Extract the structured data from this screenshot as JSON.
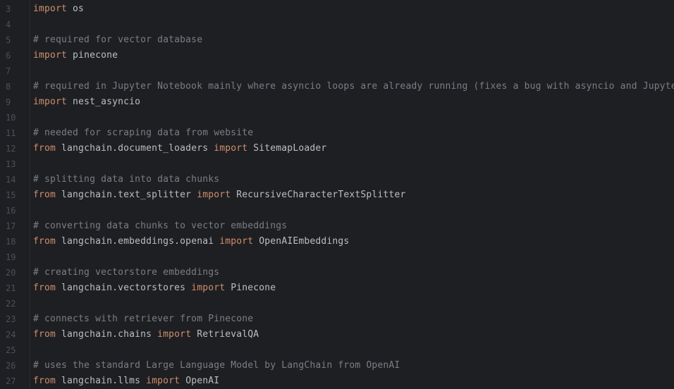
{
  "colors": {
    "background": "#1e1f22",
    "line_number": "#4b5059",
    "keyword": "#cf8e6d",
    "comment": "#7a7e85",
    "identifier": "#bcbec4"
  },
  "lines": [
    {
      "num": "3",
      "tokens": [
        {
          "t": "kw",
          "v": "import"
        },
        {
          "t": "ident",
          "v": " os"
        }
      ]
    },
    {
      "num": "4",
      "tokens": []
    },
    {
      "num": "5",
      "tokens": [
        {
          "t": "cmt",
          "v": "# required for vector database"
        }
      ]
    },
    {
      "num": "6",
      "tokens": [
        {
          "t": "kw",
          "v": "import"
        },
        {
          "t": "ident",
          "v": " pinecone"
        }
      ]
    },
    {
      "num": "7",
      "tokens": []
    },
    {
      "num": "8",
      "tokens": [
        {
          "t": "cmt",
          "v": "# required in Jupyter Notebook mainly where asyncio loops are already running (fixes a bug with asyncio and Jupyter)"
        }
      ]
    },
    {
      "num": "9",
      "tokens": [
        {
          "t": "kw",
          "v": "import"
        },
        {
          "t": "ident",
          "v": " nest_asyncio"
        }
      ]
    },
    {
      "num": "10",
      "tokens": []
    },
    {
      "num": "11",
      "tokens": [
        {
          "t": "cmt",
          "v": "# needed for scraping data from website"
        }
      ]
    },
    {
      "num": "12",
      "tokens": [
        {
          "t": "kw",
          "v": "from"
        },
        {
          "t": "ident",
          "v": " langchain.document_loaders "
        },
        {
          "t": "kw",
          "v": "import"
        },
        {
          "t": "ident",
          "v": " SitemapLoader"
        }
      ]
    },
    {
      "num": "13",
      "tokens": []
    },
    {
      "num": "14",
      "tokens": [
        {
          "t": "cmt",
          "v": "# splitting data into data chunks"
        }
      ]
    },
    {
      "num": "15",
      "tokens": [
        {
          "t": "kw",
          "v": "from"
        },
        {
          "t": "ident",
          "v": " langchain.text_splitter "
        },
        {
          "t": "kw",
          "v": "import"
        },
        {
          "t": "ident",
          "v": " RecursiveCharacterTextSplitter"
        }
      ]
    },
    {
      "num": "16",
      "tokens": []
    },
    {
      "num": "17",
      "tokens": [
        {
          "t": "cmt",
          "v": "# converting data chunks to vector embeddings"
        }
      ]
    },
    {
      "num": "18",
      "tokens": [
        {
          "t": "kw",
          "v": "from"
        },
        {
          "t": "ident",
          "v": " langchain.embeddings.openai "
        },
        {
          "t": "kw",
          "v": "import"
        },
        {
          "t": "ident",
          "v": " OpenAIEmbeddings"
        }
      ]
    },
    {
      "num": "19",
      "tokens": []
    },
    {
      "num": "20",
      "tokens": [
        {
          "t": "cmt",
          "v": "# creating vectorstore embeddings"
        }
      ]
    },
    {
      "num": "21",
      "tokens": [
        {
          "t": "kw",
          "v": "from"
        },
        {
          "t": "ident",
          "v": " langchain.vectorstores "
        },
        {
          "t": "kw",
          "v": "import"
        },
        {
          "t": "ident",
          "v": " Pinecone"
        }
      ]
    },
    {
      "num": "22",
      "tokens": []
    },
    {
      "num": "23",
      "tokens": [
        {
          "t": "cmt",
          "v": "# connects with retriever from Pinecone"
        }
      ]
    },
    {
      "num": "24",
      "tokens": [
        {
          "t": "kw",
          "v": "from"
        },
        {
          "t": "ident",
          "v": " langchain.chains "
        },
        {
          "t": "kw",
          "v": "import"
        },
        {
          "t": "ident",
          "v": " RetrievalQA"
        }
      ]
    },
    {
      "num": "25",
      "tokens": []
    },
    {
      "num": "26",
      "tokens": [
        {
          "t": "cmt",
          "v": "# uses the standard Large Language Model by LangChain from OpenAI"
        }
      ]
    },
    {
      "num": "27",
      "tokens": [
        {
          "t": "kw",
          "v": "from"
        },
        {
          "t": "ident",
          "v": " langchain.llms "
        },
        {
          "t": "kw",
          "v": "import"
        },
        {
          "t": "ident",
          "v": " OpenAI"
        }
      ]
    }
  ]
}
